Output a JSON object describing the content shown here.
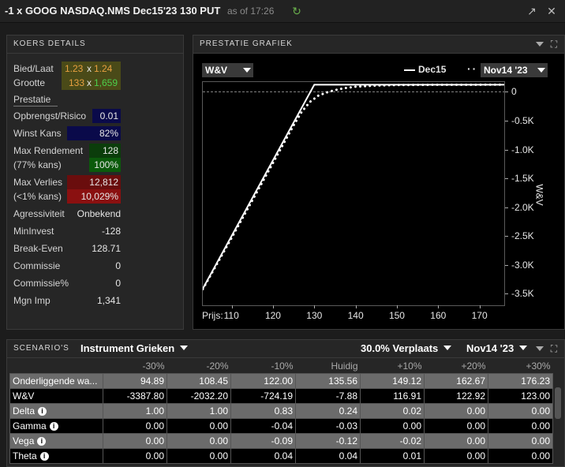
{
  "window": {
    "title": "-1 x GOOG NASDAQ.NMS Dec15'23 130 PUT",
    "as_of": "as of 17:26"
  },
  "quote_panel": {
    "header": "KOERS DETAILS",
    "bid_ask_label": "Bied/Laat",
    "bid": "1.23",
    "x1": "x",
    "ask": "1.24",
    "size_label": "Grootte",
    "bid_size": "133",
    "x2": "x",
    "ask_size": "1,659",
    "perf_label": "Prestatie",
    "rows": {
      "return_risk_label": "Opbrengst/Risico",
      "return_risk": "0.01",
      "win_chance_label": "Winst Kans",
      "win_chance": "82%",
      "max_return_label": "Max Rendement",
      "max_return": "128",
      "max_return_prob_label": "(77% kans)",
      "max_return_prob": "100%",
      "max_loss_label": "Max Verlies",
      "max_loss": "12,812",
      "max_loss_prob_label": "(<1% kans)",
      "max_loss_prob": "10,029%",
      "aggressiveness_label": "Agressiviteit",
      "aggressiveness": "Onbekend",
      "min_invest_label": "MinInvest",
      "min_invest": "-128",
      "breakeven_label": "Break-Even",
      "breakeven": "128.71",
      "commission_label": "Commissie",
      "commission": "0",
      "commission_pct_label": "Commissie%",
      "commission_pct": "0",
      "mgn_imp_label": "Mgn Imp",
      "mgn_imp": "1,341"
    }
  },
  "chart_panel": {
    "header": "PRESTATIE GRAFIEK",
    "metric_select": "W&V",
    "legend_solid": "Dec15",
    "legend_dotted_select": "Nov14 '23",
    "x_axis_prefix": "Prijs:",
    "y_axis_label": "W&V"
  },
  "chart_data": {
    "type": "line",
    "ylabel": "W&V",
    "xlabel": "Prijs:",
    "x_ticks": [
      "110",
      "120",
      "130",
      "140",
      "150",
      "160",
      "170"
    ],
    "y_ticks": [
      "0",
      "-0.5K",
      "-1.0K",
      "-1.5K",
      "-2.0K",
      "-2.5K",
      "-3.0K",
      "-3.5K"
    ],
    "xlim": [
      103,
      176
    ],
    "ylim": [
      -3700,
      170
    ],
    "grid": false,
    "legend_position": "top-right",
    "series": [
      {
        "name": "Dec15",
        "style": "solid",
        "x": [
          103,
          130,
          176
        ],
        "y": [
          -3412,
          124,
          124
        ]
      },
      {
        "name": "Nov14 '23",
        "style": "dotted",
        "x": [
          103,
          110,
          120,
          125,
          127,
          129,
          131,
          133,
          135,
          137,
          140,
          145,
          150,
          160,
          176
        ],
        "y": [
          -3420,
          -2530,
          -1230,
          -580,
          -340,
          -170,
          -65,
          -10,
          30,
          60,
          90,
          110,
          118,
          122,
          124
        ]
      }
    ]
  },
  "scenario_panel": {
    "header": "SCENARIO'S",
    "instrument_select": "Instrument Grieken",
    "shift_select": "30.0% Verplaats",
    "date_select": "Nov14 '23",
    "columns": [
      "",
      "-30%",
      "-20%",
      "-10%",
      "Huidig",
      "+10%",
      "+20%",
      "+30%"
    ],
    "rows": [
      {
        "label": "Onderliggende wa...",
        "info": false,
        "cells": [
          "94.89",
          "108.45",
          "122.00",
          "135.56",
          "149.12",
          "162.67",
          "176.23"
        ]
      },
      {
        "label": "W&V",
        "info": false,
        "cells": [
          "-3387.80",
          "-2032.20",
          "-724.19",
          "-7.88",
          "116.91",
          "122.92",
          "123.00"
        ]
      },
      {
        "label": "Delta",
        "info": true,
        "cells": [
          "1.00",
          "1.00",
          "0.83",
          "0.24",
          "0.02",
          "0.00",
          "0.00"
        ]
      },
      {
        "label": "Gamma",
        "info": true,
        "cells": [
          "0.00",
          "0.00",
          "-0.04",
          "-0.03",
          "0.00",
          "0.00",
          "0.00"
        ]
      },
      {
        "label": "Vega",
        "info": true,
        "cells": [
          "0.00",
          "0.00",
          "-0.09",
          "-0.12",
          "-0.02",
          "0.00",
          "0.00"
        ]
      },
      {
        "label": "Theta",
        "info": true,
        "cells": [
          "0.00",
          "0.00",
          "0.04",
          "0.04",
          "0.01",
          "0.00",
          "0.00"
        ]
      }
    ]
  },
  "colors": {
    "bid_ask": "#e8a040",
    "ask_size": "#4ccf4c",
    "navy": "#0a0a4a",
    "green_dark": "#0b3d0b",
    "red_dark": "#6a0d0d"
  }
}
